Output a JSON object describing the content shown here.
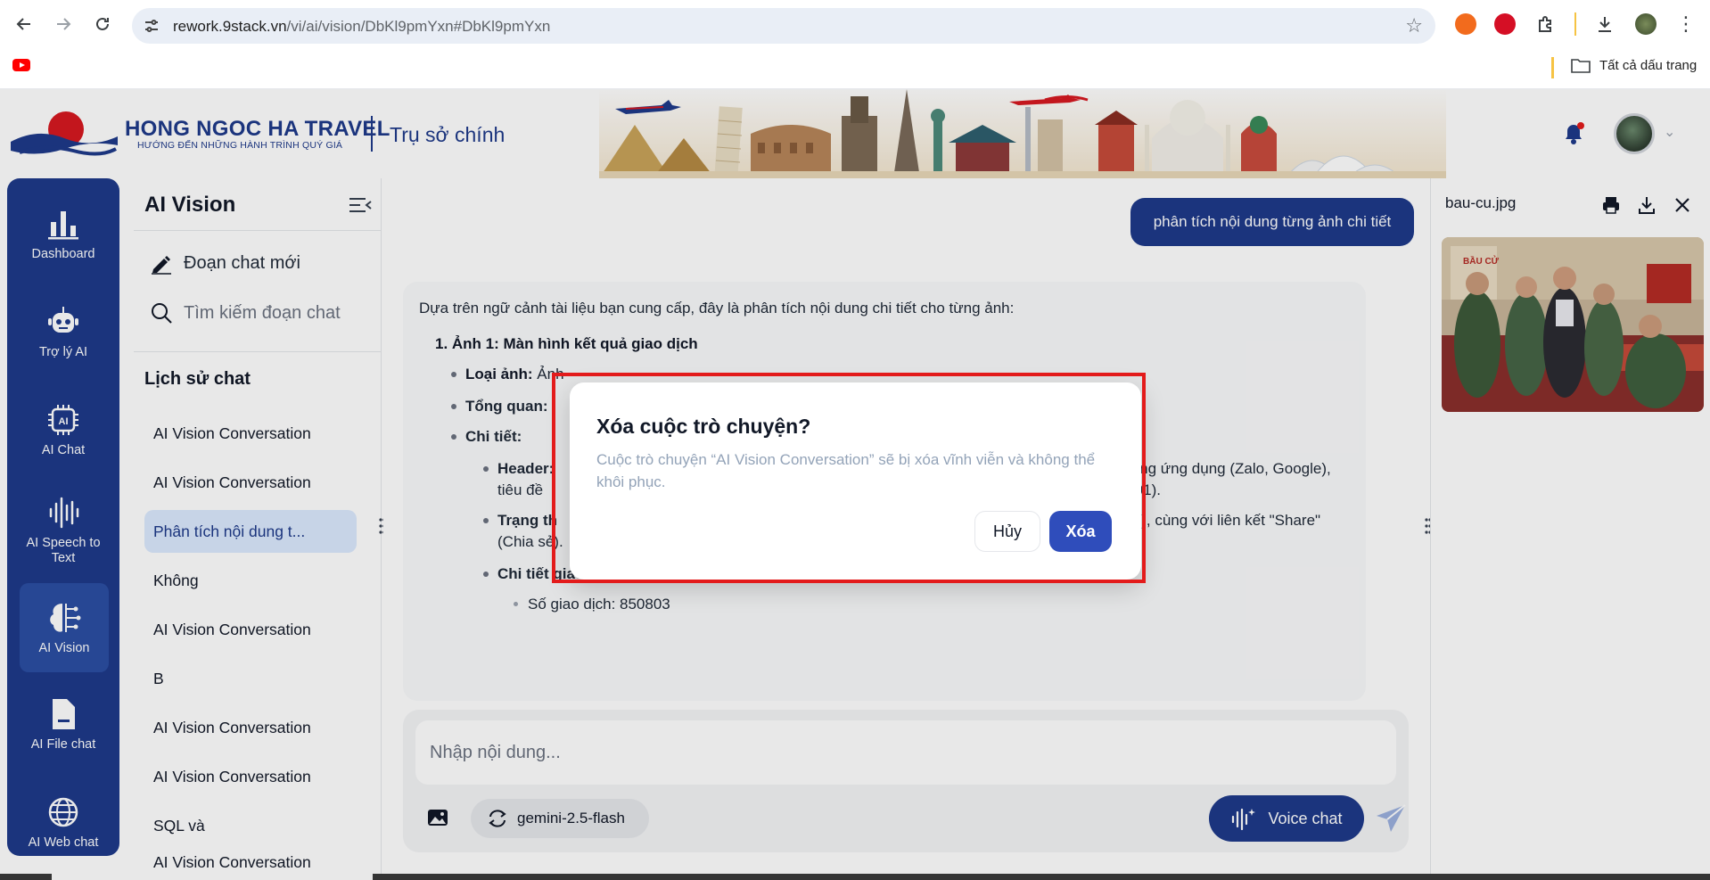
{
  "browser": {
    "url_host": "rework.9stack.vn",
    "url_path": "/vi/ai/vision/DbKl9pmYxn#DbKl9pmYxn",
    "bookmarks_all": "Tất cả dấu trang"
  },
  "header": {
    "brand_name": "HONG NGOC HA TRAVEL",
    "brand_tagline": "HƯỚNG ĐẾN NHỮNG HÀNH TRÌNH QUÝ GIÁ",
    "office": "Trụ sở chính"
  },
  "rail": {
    "items": [
      {
        "label": "Dashboard",
        "icon": "bar-chart-icon"
      },
      {
        "label": "Trợ lý AI",
        "icon": "robot-icon"
      },
      {
        "label": "AI Chat",
        "icon": "ai-chip-icon"
      },
      {
        "label": "AI Speech to Text",
        "icon": "soundwave-icon"
      },
      {
        "label": "AI Vision",
        "icon": "brain-icon"
      },
      {
        "label": "AI File chat",
        "icon": "file-icon"
      },
      {
        "label": "AI Web chat",
        "icon": "globe-icon"
      }
    ],
    "active": "AI Vision"
  },
  "history": {
    "title": "AI Vision",
    "new_chat": "Đoạn chat mới",
    "search_placeholder": "Tìm kiếm đoạn chat",
    "section": "Lịch sử chat",
    "items": [
      "AI Vision Conversation",
      "AI Vision Conversation",
      "Phân tích nội dung t...",
      "Không",
      "AI Vision Conversation",
      "B",
      "AI Vision Conversation",
      "AI Vision Conversation",
      "SQL và",
      "AI Vision Conversation"
    ],
    "active_index": 2
  },
  "chat": {
    "user_message": "phân tích nội dung từng ảnh chi tiết",
    "ai": {
      "intro": "Dựa trên ngữ cảnh tài liệu bạn cung cấp, đây là phân tích nội dung chi tiết cho từng ảnh:",
      "item1_title": "1.   Ảnh 1: Màn hình kết quả giao dịch",
      "type_label": "Loại ảnh:",
      "type_text": "Ảnh",
      "overview_label": "Tổng quan:",
      "detail_label": "Chi tiết:",
      "header_label": "Header:",
      "header_text": "ợng ứng dụng (Zalo, Google),",
      "header_line2a": "tiêu đề",
      "header_line2b": "(01).",
      "status_label": "Trạng th",
      "status_text": "G), cùng với liên kết \"Share\"",
      "status_line2": "(Chia sẻ).",
      "txn_label": "Chi tiết giao dịch:",
      "txn_no": "Số giao dịch: 850803"
    },
    "composer_placeholder": "Nhập nội dung...",
    "model": "gemini-2.5-flash",
    "voice_label": "Voice chat"
  },
  "preview": {
    "filename": "bau-cu.jpg"
  },
  "dialog": {
    "title": "Xóa cuộc trò chuyện?",
    "message": "Cuộc trò chuyện “AI Vision Conversation” sẽ bị xóa vĩnh viễn và không thể khôi phục.",
    "cancel": "Hủy",
    "confirm": "Xóa"
  },
  "colors": {
    "brand": "#1e3a8a",
    "confirm": "#2f4dbb",
    "highlight": "#e31b1b"
  }
}
